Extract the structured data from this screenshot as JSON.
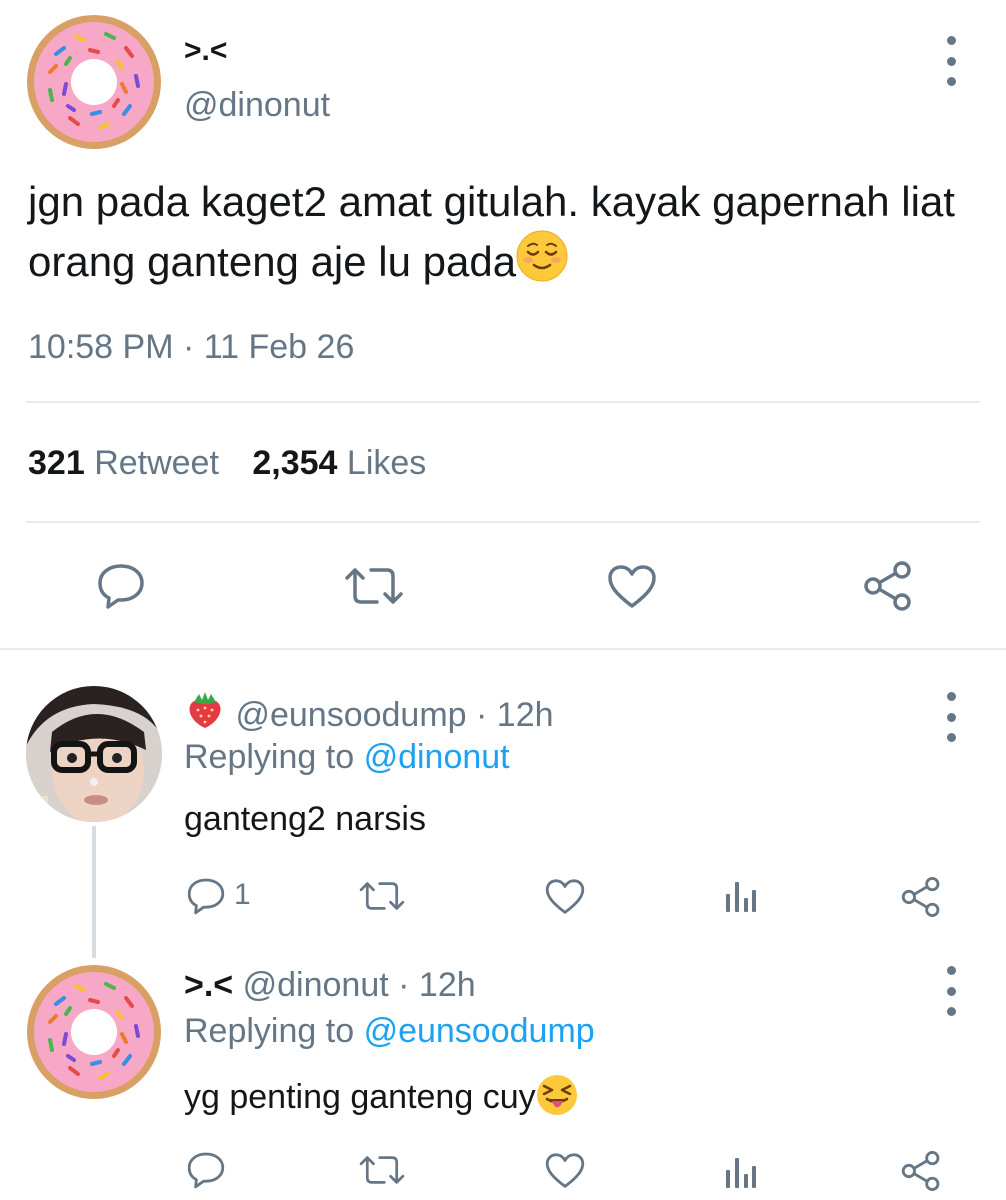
{
  "main_tweet": {
    "display_name": ">.<",
    "handle": "@dinonut",
    "text": "jgn pada kaget2 amat gitulah. kayak gapernah liat orang ganteng aje lu pada",
    "emoji": "relieved-face",
    "time": "10:58 PM",
    "separator": "·",
    "date": "11 Feb 26",
    "retweet_count": "321",
    "retweet_label": "Retweet",
    "like_count": "2,354",
    "like_label": "Likes"
  },
  "replies": [
    {
      "badge": "strawberry",
      "display_name": "",
      "handle": "@eunsoodump",
      "meta": "· 12h",
      "replying_label": "Replying to",
      "replying_to": "@dinonut",
      "text": "ganteng2 narsis",
      "reply_count": "1",
      "avatar": "girl-with-glasses"
    },
    {
      "display_name": ">.<",
      "handle": "@dinonut",
      "meta": "· 12h",
      "replying_label": "Replying to",
      "replying_to": "@eunsoodump",
      "text": "yg penting ganteng cuy",
      "emoji": "squinting-tongue-face",
      "reply_count": "",
      "avatar": "pink-donut"
    }
  ],
  "colors": {
    "text": "#14171a",
    "secondary": "#657786",
    "link": "#1da1f2",
    "divider": "#e6ecf0",
    "donut_icing": "#f7a8c6",
    "donut_dough": "#d9a066"
  }
}
